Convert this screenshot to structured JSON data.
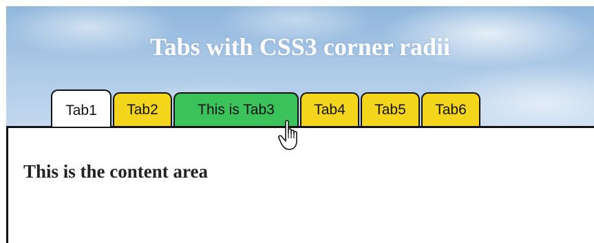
{
  "header": {
    "title": "Tabs with CSS3 corner radii"
  },
  "tabs": [
    {
      "label": "Tab1",
      "state": "active"
    },
    {
      "label": "Tab2",
      "state": "normal"
    },
    {
      "label": "This is Tab3",
      "state": "hover"
    },
    {
      "label": "Tab4",
      "state": "normal"
    },
    {
      "label": "Tab5",
      "state": "normal"
    },
    {
      "label": "Tab6",
      "state": "normal"
    }
  ],
  "content": {
    "text": "This is the content area"
  },
  "colors": {
    "tab_normal": "#f3d61c",
    "tab_hover": "#3cc25b",
    "tab_active": "#ffffff",
    "border": "#111111"
  },
  "icons": {
    "cursor": "hand-pointer-cursor-icon"
  }
}
